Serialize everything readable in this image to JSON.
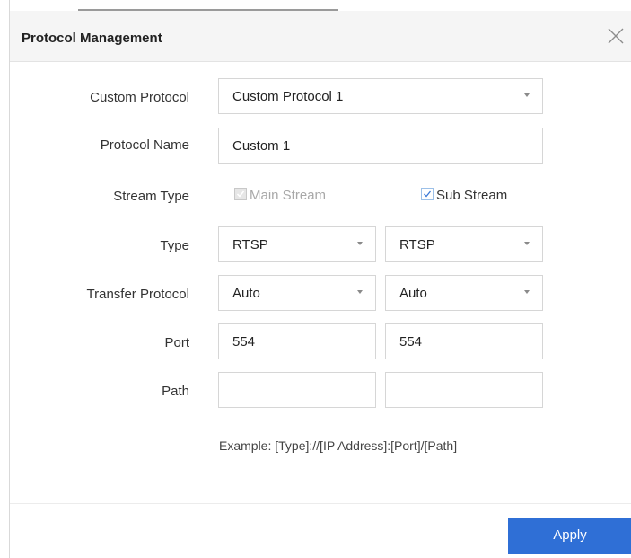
{
  "dialog": {
    "title": "Protocol Management",
    "close_icon": "close-icon"
  },
  "form": {
    "custom_protocol": {
      "label": "Custom Protocol",
      "value": "Custom Protocol 1"
    },
    "protocol_name": {
      "label": "Protocol Name",
      "value": "Custom 1"
    },
    "stream_type": {
      "label": "Stream Type",
      "main": {
        "label": "Main Stream",
        "checked": true,
        "disabled": true
      },
      "sub": {
        "label": "Sub Stream",
        "checked": true,
        "disabled": false
      }
    },
    "type": {
      "label": "Type",
      "main_value": "RTSP",
      "sub_value": "RTSP"
    },
    "transfer_protocol": {
      "label": "Transfer Protocol",
      "main_value": "Auto",
      "sub_value": "Auto"
    },
    "port": {
      "label": "Port",
      "main_value": "554",
      "sub_value": "554"
    },
    "path": {
      "label": "Path",
      "main_value": "",
      "sub_value": ""
    },
    "example": "Example: [Type]://[IP Address]:[Port]/[Path]"
  },
  "footer": {
    "apply_label": "Apply"
  },
  "colors": {
    "accent": "#2f6fd6",
    "header_bg": "#f5f5f5"
  }
}
